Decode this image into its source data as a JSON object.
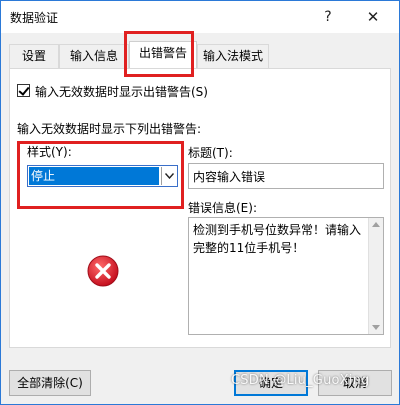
{
  "window": {
    "title": "数据验证",
    "help_glyph": "?",
    "close_glyph": "✕"
  },
  "tabs": [
    {
      "label": "设置",
      "active": false
    },
    {
      "label": "输入信息",
      "active": false
    },
    {
      "label": "出错警告",
      "active": true
    },
    {
      "label": "输入法模式",
      "active": false
    }
  ],
  "show_error_checkbox": {
    "label": "输入无效数据时显示出错警告(S)",
    "checked": true
  },
  "section_label": "输入无效数据时显示下列出错警告:",
  "style": {
    "label": "样式(Y):",
    "selected": "停止",
    "icon": "chevron-down-icon"
  },
  "title_field": {
    "label": "标题(T):",
    "value": "内容输入错误"
  },
  "error_message": {
    "label": "错误信息(E):",
    "value": "检测到手机号位数异常！请输入完整的11位手机号！"
  },
  "stop_icon": {
    "icon": "error-stop-icon",
    "color": "#e81123"
  },
  "buttons": {
    "clear_all": "全部清除(C)",
    "ok": "确定",
    "cancel": "取消"
  },
  "watermark": "CSDN @Liu_GuoXing",
  "colors": {
    "accent": "#0078d7",
    "annotation": "#e02020"
  }
}
